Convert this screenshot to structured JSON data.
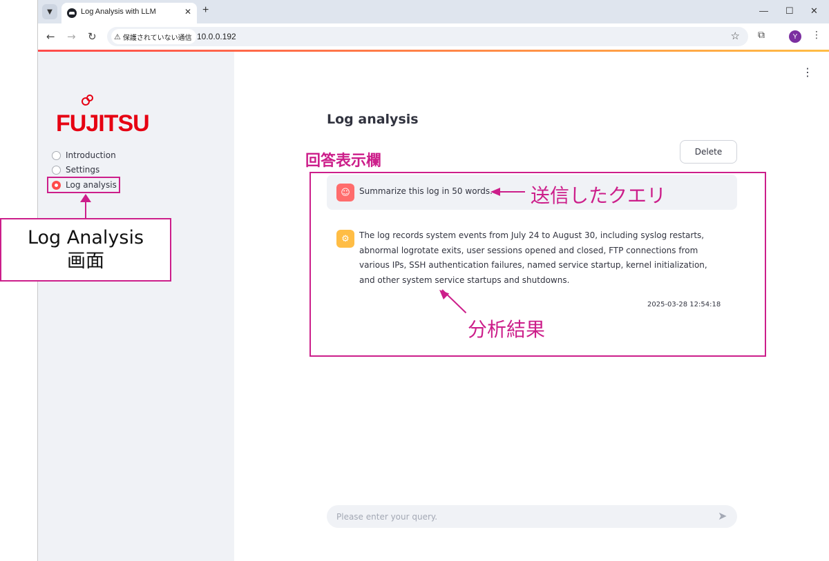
{
  "browser": {
    "tab_title": "Log Analysis with LLM",
    "tab_close": "✕",
    "new_tab": "+",
    "security_warning": "保護されていない通信",
    "url": "10.0.0.192",
    "profile_initial": "Y"
  },
  "sidebar": {
    "logo": "FUJITSU",
    "nav": [
      {
        "label": "Introduction",
        "selected": false
      },
      {
        "label": "Settings",
        "selected": false
      },
      {
        "label": "Log analysis",
        "selected": true
      }
    ]
  },
  "main": {
    "title": "Log analysis",
    "delete_label": "Delete",
    "user_message": "Summarize this log in 50 words.",
    "assistant_message": "The log records system events from July 24 to August 30, including syslog restarts, abnormal logrotate exits, user sessions opened and closed, FTP connections from various IPs, SSH authentication failures, named service startup, kernel initialization, and other system service startups and shutdowns.",
    "assistant_timestamp": "2025-03-28 12:54:18",
    "input_placeholder": "Please enter your query."
  },
  "annotations": {
    "response_area_label": "回答表示欄",
    "sent_query_label": "送信したクエリ",
    "result_label": "分析結果",
    "screen_callout_line1": "Log Analysis",
    "screen_callout_line2": "画面",
    "color": "#cc1e8a"
  },
  "colors": {
    "accent": "#ff4b4b",
    "assistant_avatar": "#ffbd45",
    "brand": "#e60012"
  }
}
